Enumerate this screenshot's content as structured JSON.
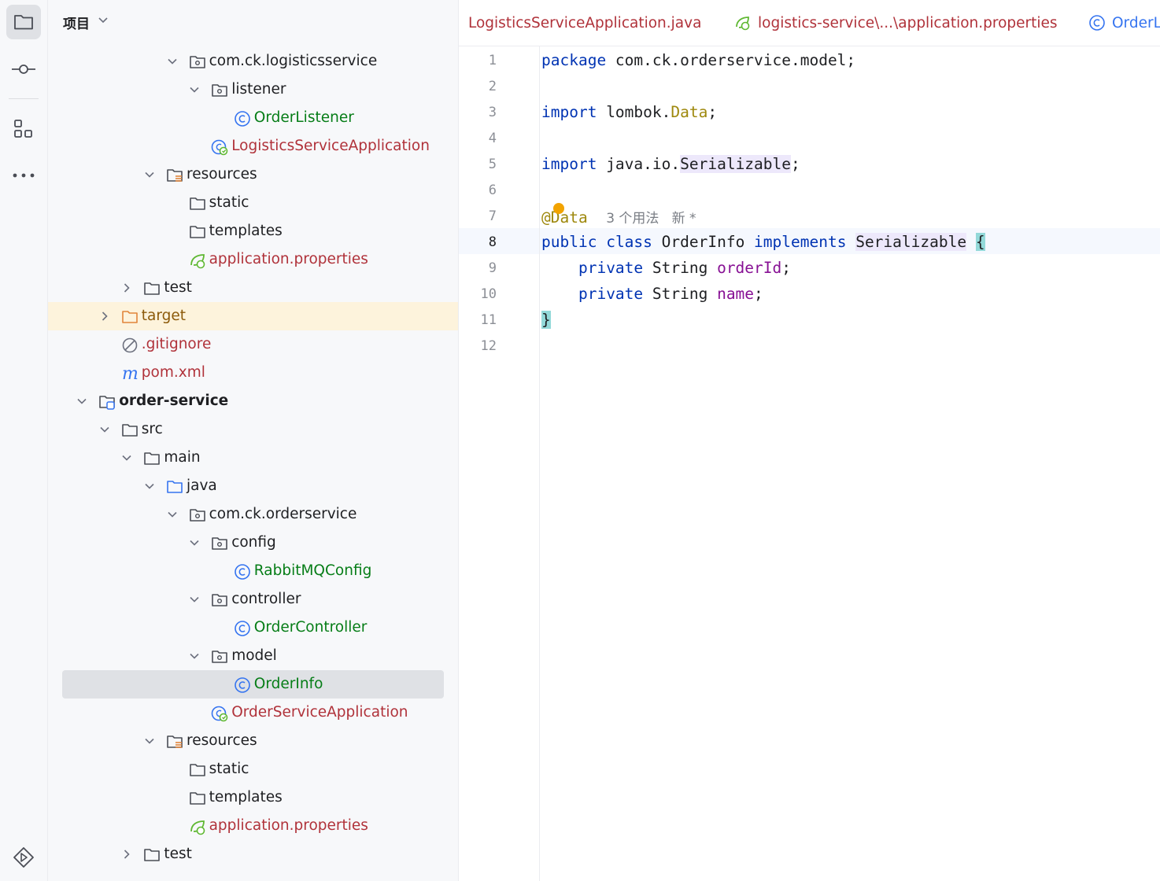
{
  "panel": {
    "title": "项目"
  },
  "tree": [
    {
      "label": "com.ck.logisticsservice",
      "icon": "package-icon",
      "color": "default",
      "chevron": "down"
    },
    {
      "label": "listener",
      "icon": "package-icon",
      "color": "default",
      "chevron": "down"
    },
    {
      "label": "OrderListener",
      "icon": "class-icon",
      "color": "green",
      "chevron": "none"
    },
    {
      "label": "LogisticsServiceApplication",
      "icon": "spring-boot-class-icon",
      "color": "red",
      "chevron": "none"
    },
    {
      "label": "resources",
      "icon": "resources-folder-icon",
      "color": "default",
      "chevron": "down"
    },
    {
      "label": "static",
      "icon": "folder-icon",
      "color": "default",
      "chevron": "none"
    },
    {
      "label": "templates",
      "icon": "folder-icon",
      "color": "default",
      "chevron": "none"
    },
    {
      "label": "application.properties",
      "icon": "spring-properties-icon",
      "color": "red",
      "chevron": "none"
    },
    {
      "label": "test",
      "icon": "folder-icon",
      "color": "default",
      "chevron": "right"
    },
    {
      "label": "target",
      "icon": "excluded-folder-icon",
      "color": "orange",
      "chevron": "right"
    },
    {
      "label": ".gitignore",
      "icon": "ignored-file-icon",
      "color": "red",
      "chevron": "none"
    },
    {
      "label": "pom.xml",
      "icon": "maven-icon",
      "color": "red",
      "chevron": "none"
    },
    {
      "label": "order-service",
      "icon": "module-icon",
      "color": "bold",
      "chevron": "down"
    },
    {
      "label": "src",
      "icon": "folder-icon",
      "color": "default",
      "chevron": "down"
    },
    {
      "label": "main",
      "icon": "folder-icon",
      "color": "default",
      "chevron": "down"
    },
    {
      "label": "java",
      "icon": "source-folder-icon",
      "color": "default",
      "chevron": "down"
    },
    {
      "label": "com.ck.orderservice",
      "icon": "package-icon",
      "color": "default",
      "chevron": "down"
    },
    {
      "label": "config",
      "icon": "package-icon",
      "color": "default",
      "chevron": "down"
    },
    {
      "label": "RabbitMQConfig",
      "icon": "class-icon",
      "color": "green",
      "chevron": "none"
    },
    {
      "label": "controller",
      "icon": "package-icon",
      "color": "default",
      "chevron": "down"
    },
    {
      "label": "OrderController",
      "icon": "class-icon",
      "color": "green",
      "chevron": "none"
    },
    {
      "label": "model",
      "icon": "package-icon",
      "color": "default",
      "chevron": "down"
    },
    {
      "label": "OrderInfo",
      "icon": "class-icon",
      "color": "green",
      "chevron": "none"
    },
    {
      "label": "OrderServiceApplication",
      "icon": "spring-boot-class-icon",
      "color": "red",
      "chevron": "none"
    },
    {
      "label": "resources",
      "icon": "resources-folder-icon",
      "color": "default",
      "chevron": "down"
    },
    {
      "label": "static",
      "icon": "folder-icon",
      "color": "default",
      "chevron": "none"
    },
    {
      "label": "templates",
      "icon": "folder-icon",
      "color": "default",
      "chevron": "none"
    },
    {
      "label": "application.properties",
      "icon": "spring-properties-icon",
      "color": "red",
      "chevron": "none"
    },
    {
      "label": "test",
      "icon": "folder-icon",
      "color": "default",
      "chevron": "right"
    }
  ],
  "tabs": [
    {
      "label": "LogisticsServiceApplication.java",
      "icon": "none"
    },
    {
      "label": "logistics-service\\...\\application.properties",
      "icon": "spring-properties-icon"
    },
    {
      "label": "OrderL",
      "icon": "class-icon"
    }
  ],
  "editor": {
    "line_numbers": [
      "1",
      "2",
      "3",
      "4",
      "5",
      "6",
      "7",
      "8",
      "9",
      "10",
      "11",
      "12"
    ],
    "current_line": "8",
    "lines": [
      [
        {
          "t": "package",
          "c": "kw"
        },
        {
          "t": " com.ck.orderservice.model;",
          "c": ""
        }
      ],
      [],
      [
        {
          "t": "import",
          "c": "kw"
        },
        {
          "t": " lombok.",
          "c": ""
        },
        {
          "t": "Data",
          "c": "ann"
        },
        {
          "t": ";",
          "c": ""
        }
      ],
      [],
      [
        {
          "t": "import",
          "c": "kw"
        },
        {
          "t": " java.io.",
          "c": ""
        },
        {
          "t": "Serializable",
          "c": "hl"
        },
        {
          "t": ";",
          "c": ""
        }
      ],
      [],
      [
        {
          "t": "@Data",
          "c": "ann"
        },
        {
          "t": "  ",
          "c": ""
        },
        {
          "t": "3 个用法   新 *",
          "c": "hint"
        }
      ],
      [
        {
          "t": "public",
          "c": "kw"
        },
        {
          "t": " ",
          "c": ""
        },
        {
          "t": "class",
          "c": "kw"
        },
        {
          "t": " OrderInfo ",
          "c": ""
        },
        {
          "t": "implements",
          "c": "kw"
        },
        {
          "t": " ",
          "c": ""
        },
        {
          "t": "Serializable",
          "c": "hl"
        },
        {
          "t": " ",
          "c": ""
        },
        {
          "t": "{",
          "c": "brace"
        }
      ],
      [
        {
          "t": "    ",
          "c": ""
        },
        {
          "t": "private",
          "c": "kw"
        },
        {
          "t": " String ",
          "c": ""
        },
        {
          "t": "orderId",
          "c": "fld"
        },
        {
          "t": ";",
          "c": ""
        }
      ],
      [
        {
          "t": "    ",
          "c": ""
        },
        {
          "t": "private",
          "c": "kw"
        },
        {
          "t": " String ",
          "c": ""
        },
        {
          "t": "name",
          "c": "fld"
        },
        {
          "t": ";",
          "c": ""
        }
      ],
      [
        {
          "t": "}",
          "c": "brace"
        }
      ],
      []
    ]
  }
}
